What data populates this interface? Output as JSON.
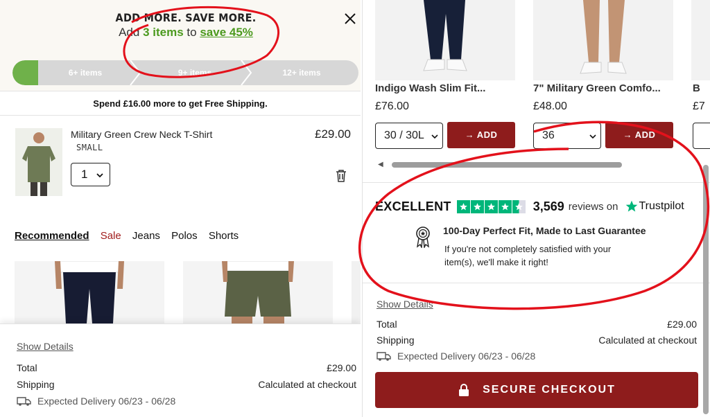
{
  "promo": {
    "title": "ADD MORE. SAVE MORE.",
    "sub_prefix": "Add",
    "sub_items": "3 items",
    "sub_to": "to",
    "sub_save": "save 45%",
    "tiers": [
      "6+ items",
      "9+ items",
      "12+ items"
    ],
    "progress_fraction": 0.07
  },
  "shipping_banner": "Spend £16.00 more to get Free Shipping.",
  "cart_item": {
    "name": "Military Green Crew Neck T-Shirt",
    "size": "SMALL",
    "price": "£29.00",
    "quantity": "1"
  },
  "recommended": {
    "tabs": [
      "Recommended",
      "Sale",
      "Jeans",
      "Polos",
      "Shorts"
    ]
  },
  "summary_left": {
    "show_details": "Show Details",
    "total_label": "Total",
    "total_value": "£29.00",
    "shipping_label": "Shipping",
    "shipping_value": "Calculated at checkout",
    "delivery_label": "Expected Delivery",
    "delivery_dates": "06/23 - 06/28"
  },
  "products": [
    {
      "name": "Indigo Wash Slim Fit...",
      "price": "£76.00",
      "size": "30 / 30L",
      "add": "→ ADD"
    },
    {
      "name": "7\" Military Green Comfo...",
      "price": "£48.00",
      "size": "36",
      "add": "→ ADD"
    },
    {
      "name": "B",
      "price": "£7"
    }
  ],
  "trustpilot": {
    "rating_word": "EXCELLENT",
    "review_count": "3,569",
    "reviews_on": "reviews on",
    "brand": "Trustpilot"
  },
  "guarantee": {
    "title": "100-Day Perfect Fit, Made to Last Guarantee",
    "text": "If you're not completely satisfied with your item(s), we'll make it right!"
  },
  "summary_right": {
    "show_details": "Show Details",
    "total_label": "Total",
    "total_value": "£29.00",
    "shipping_label": "Shipping",
    "shipping_value": "Calculated at checkout",
    "delivery_label": "Expected Delivery",
    "delivery_dates": "06/23 - 06/28",
    "checkout_label": "SECURE CHECKOUT"
  },
  "colors": {
    "brand_red": "#8e1c1c",
    "promo_green": "#4c9a1f",
    "trustpilot_green": "#00b67a",
    "annotation_red": "#e3111b"
  }
}
